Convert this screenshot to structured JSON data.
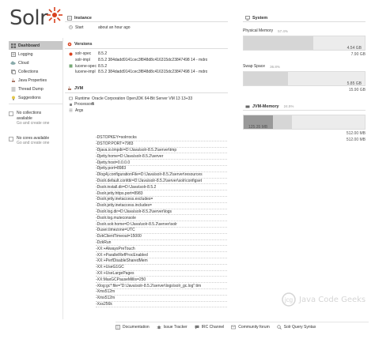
{
  "logo": {
    "wordmark": "Solr"
  },
  "sidebar": {
    "items": [
      {
        "label": "Dashboard",
        "icon": "dashboard-icon",
        "active": true
      },
      {
        "label": "Logging",
        "icon": "logging-icon"
      },
      {
        "label": "Cloud",
        "icon": "cloud-icon"
      },
      {
        "label": "Collections",
        "icon": "collections-icon"
      },
      {
        "label": "Java Properties",
        "icon": "java-icon"
      },
      {
        "label": "Thread Dump",
        "icon": "thread-icon"
      },
      {
        "label": "Suggestions",
        "icon": "bulb-icon"
      }
    ],
    "collections_note": {
      "line1": "No collections",
      "line2": "available",
      "line3": "Go and create one"
    },
    "cores_note": {
      "line1": "No cores available",
      "line2": "Go and create one"
    }
  },
  "instance": {
    "title": "Instance",
    "start_label": "Start",
    "start_value": "about an hour ago"
  },
  "versions": {
    "title": "Versions",
    "rows": [
      {
        "key": "solr-spec",
        "value": "8.5.2"
      },
      {
        "key": "solr-impl",
        "value": "8.5.2 384dadd9141cec3f848d8c416315dc23847498 14 - mdro"
      },
      {
        "key": "lucene-spec",
        "value": "8.5.2"
      },
      {
        "key": "lucene-impl",
        "value": "8.5.2 384dadd9141cec3f848d8c416315dc23847498 14 - mdro"
      }
    ]
  },
  "jvm": {
    "title": "JVM",
    "runtime_label": "Runtime",
    "runtime_value": "Oracle Corporation OpenJDK 64-Bit Server VM 13 13+33",
    "processors_label": "Processors",
    "processors_value": "8",
    "args_label": "Args",
    "args": [
      "-DSTOPKEY=solrrocks",
      "-DSTOP.PORT=7983",
      "-Djava.io.tmpdir=D:\\Java\\solr-8.5.2\\server\\tmp",
      "-Djetty.home=D:\\Java\\solr-8.5.2\\server",
      "-Djetty.host=0.0.0.0",
      "-Djetty.port=8983",
      "-Dlog4j.configurationFile=D:\\Java\\solr-8.5.2\\server\\resources",
      "-Dsolr.default.confdir=D:\\Java\\solr-8.5.2\\server\\solr\\configset",
      "-Dsolr.install.dir=D:\\Java\\solr-8.5.2",
      "-Dsolr.jetty.https.port=8983",
      "-Dsolr.jetty.inetaccess.excludes=",
      "-Dsolr.jetty.inetaccess.includes=",
      "-Dsolr.log.dir=D:\\Java\\solr-8.5.2\\server\\logs",
      "-Dsolr.log.muteconsole",
      "-Dsolr.solr.home=D:\\Java\\solr-8.5.2\\server\\solr",
      "-Duser.timezone=UTC",
      "-DzkClientTimeout=15000",
      "-DzkRun",
      "-XX:+AlwaysPreTouch",
      "-XX:+ParallelRefProcEnabled",
      "-XX:+PerfDisableSharedMem",
      "-XX:+UseG1GC",
      "-XX:+UseLargePages",
      "-XX:MaxGCPauseMillis=250",
      "-Xlog:gc*:file=\"D:\\Java\\solr-8.5.2\\server\\logs\\solr_gc.log\":tim",
      "-Xms512m",
      "-Xmx512m",
      "-Xss256k"
    ]
  },
  "system": {
    "title": "System",
    "physical": {
      "label": "Physical Memory",
      "pct": "57.4%",
      "used": "4.54 GB",
      "total": "7.90 GB",
      "fraction": 0.574
    },
    "swap": {
      "label": "Swap Space",
      "pct": "36.8%",
      "used": "5.85 GB",
      "total": "15.90 GB",
      "fraction": 0.368
    }
  },
  "jvm_memory": {
    "title": "JVM-Memory",
    "pct": "24.5%",
    "used": "125.35 MB",
    "total1": "512.00 MB",
    "total2": "512.00 MB",
    "fraction_dark": 0.245,
    "fraction_light": 0.4
  },
  "footer": {
    "items": [
      {
        "label": "Documentation",
        "icon": "book-icon"
      },
      {
        "label": "Issue Tracker",
        "icon": "bug-icon"
      },
      {
        "label": "IRC Channel",
        "icon": "chat-icon"
      },
      {
        "label": "Community forum",
        "icon": "mail-icon"
      },
      {
        "label": "Solr Query Syntax",
        "icon": "query-icon"
      }
    ]
  },
  "watermark": {
    "text": "Java Code Geeks"
  },
  "colors": {
    "accent": "#d9411e",
    "active_bg": "#c8c8c8",
    "bar_bg": "#ececec",
    "bar_used": "#d6d6d6",
    "bar_dark": "#999999"
  }
}
